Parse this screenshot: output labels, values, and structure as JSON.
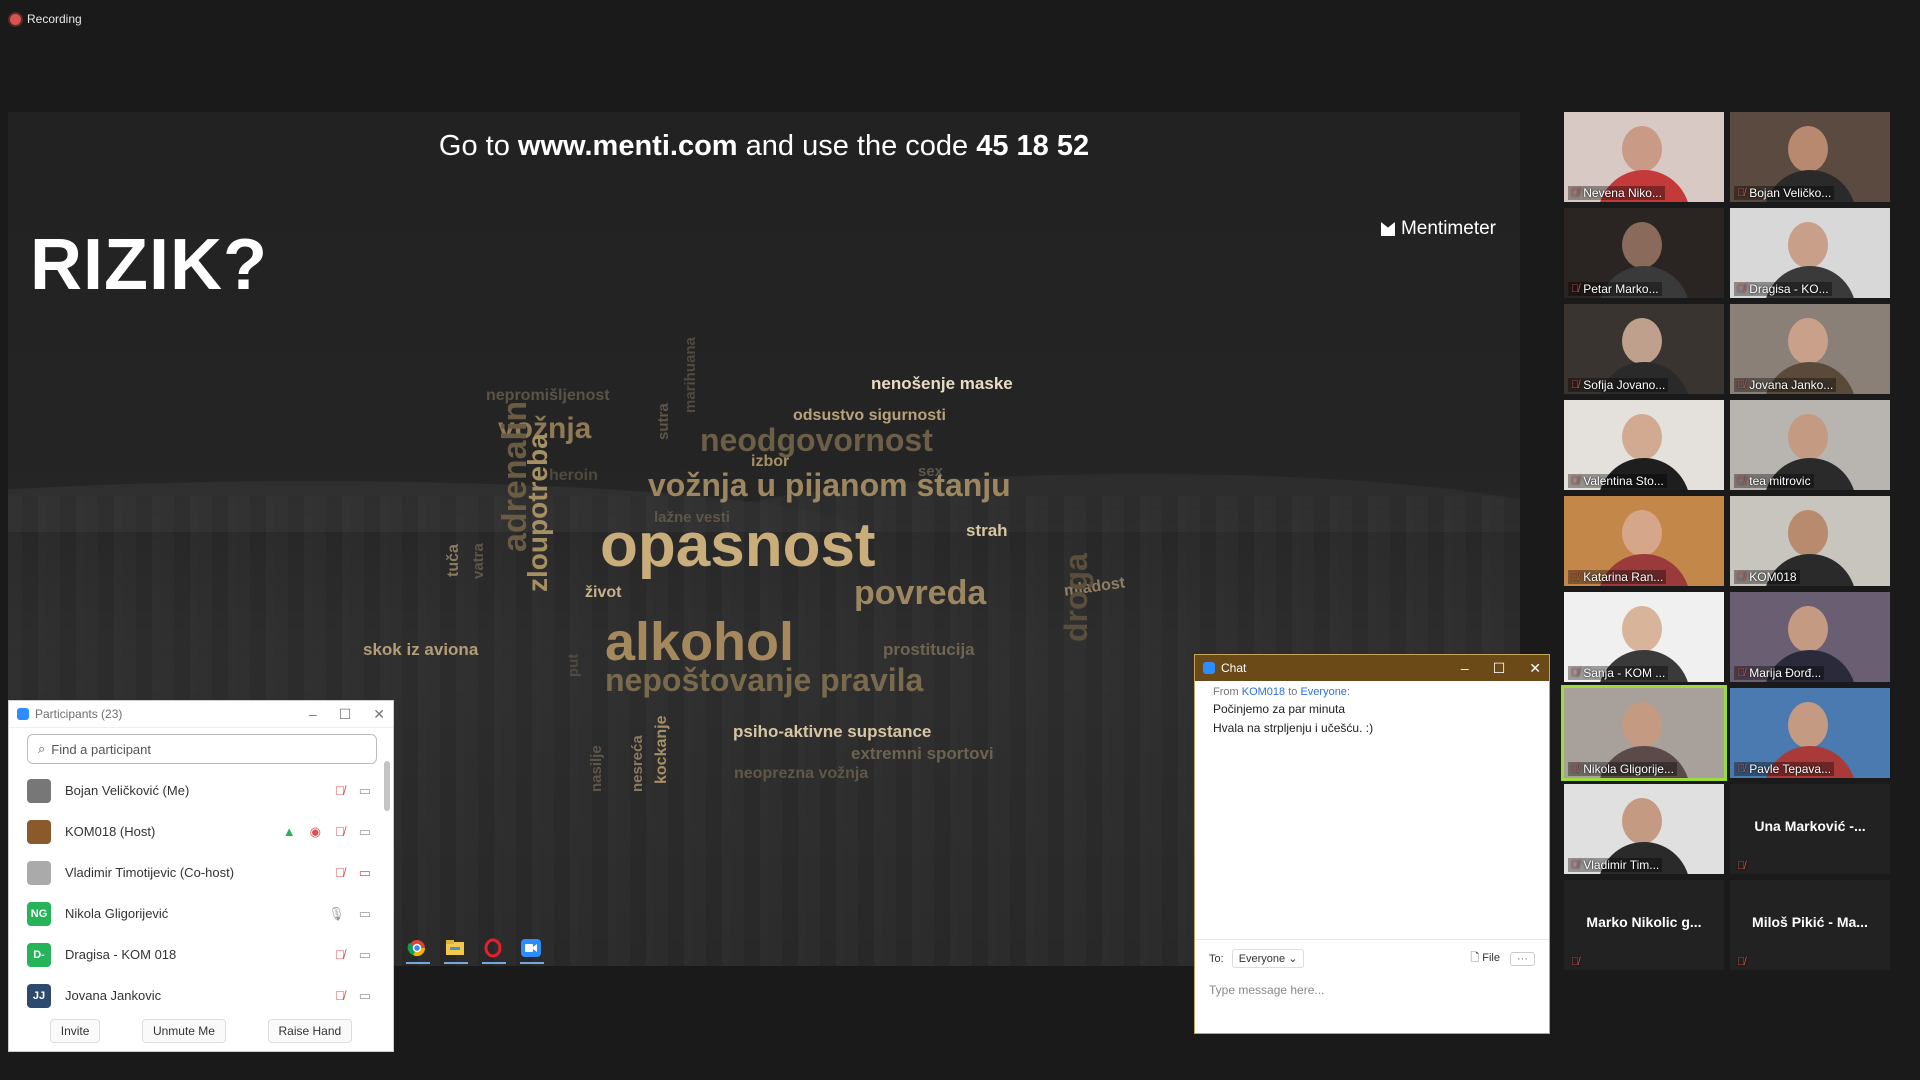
{
  "recording": {
    "label": "Recording"
  },
  "slide": {
    "code_prefix": "Go to ",
    "url": "www.menti.com",
    "code_mid": " and use the code ",
    "code": "45 18 52",
    "brand": "Mentimeter",
    "title": "RIZIK?",
    "words": [
      {
        "text": "nenošenje maske",
        "size": 17,
        "color": "#e8dcc3"
      },
      {
        "text": "nepromišljenost",
        "size": 16,
        "color": "#5a5446"
      },
      {
        "text": "vožnja",
        "size": 30,
        "color": "#8f7a55"
      },
      {
        "text": "sutra",
        "size": 15,
        "color": "#5d564a"
      },
      {
        "text": "marihuana",
        "size": 15,
        "color": "#4f493f"
      },
      {
        "text": "odsustvo sigurnosti",
        "size": 16,
        "color": "#b9a27a"
      },
      {
        "text": "neodgovornost",
        "size": 32,
        "color": "#6c5f48"
      },
      {
        "text": "izbor",
        "size": 16,
        "color": "#a68f63"
      },
      {
        "text": "heroin",
        "size": 16,
        "color": "#4f493f"
      },
      {
        "text": "sex",
        "size": 15,
        "color": "#5d564a"
      },
      {
        "text": "vožnja u pijanom stanju",
        "size": 32,
        "color": "#9d8760"
      },
      {
        "text": "lažne vesti",
        "size": 15,
        "color": "#5d564a"
      },
      {
        "text": "adrenalin",
        "size": 34,
        "color": "#6a5c43"
      },
      {
        "text": "tuča",
        "size": 16,
        "color": "#8a7a5d"
      },
      {
        "text": "vatra",
        "size": 15,
        "color": "#5d564a"
      },
      {
        "text": "zloupotreba",
        "size": 28,
        "color": "#a68f63"
      },
      {
        "text": "opasnost",
        "size": 62,
        "color": "#c9ae7b"
      },
      {
        "text": "strah",
        "size": 17,
        "color": "#d6c6a1"
      },
      {
        "text": "život",
        "size": 16,
        "color": "#c7b38a"
      },
      {
        "text": "povreda",
        "size": 34,
        "color": "#9d8760"
      },
      {
        "text": "mladost",
        "size": 16,
        "color": "#8f7f60"
      },
      {
        "text": "alkohol",
        "size": 54,
        "color": "#a5895d"
      },
      {
        "text": "put",
        "size": 15,
        "color": "#4f493f"
      },
      {
        "text": "droga",
        "size": 32,
        "color": "#5a4f3c"
      },
      {
        "text": "skok iz aviona",
        "size": 17,
        "color": "#b39e78"
      },
      {
        "text": "prostitucija",
        "size": 17,
        "color": "#6f6450"
      },
      {
        "text": "nepoštovanje pravila",
        "size": 32,
        "color": "#7a6a4d"
      },
      {
        "text": "psiho-aktivne supstance",
        "size": 17,
        "color": "#d6c6a1"
      },
      {
        "text": "nasilje",
        "size": 15,
        "color": "#5d564a"
      },
      {
        "text": "nesreća",
        "size": 15,
        "color": "#8a7a5d"
      },
      {
        "text": "kockanje",
        "size": 16,
        "color": "#a68f63"
      },
      {
        "text": "extremni sportovi",
        "size": 17,
        "color": "#6c6250"
      },
      {
        "text": "neoprezna vožnja",
        "size": 16,
        "color": "#5f5848"
      }
    ]
  },
  "participants": {
    "title": "Participants (23)",
    "search_placeholder": "Find a participant",
    "rows": [
      {
        "name": "Bojan Veličković (Me)",
        "initials": "",
        "avatar_color": "#777"
      },
      {
        "name": "KOM018 (Host)",
        "initials": "",
        "avatar_color": "#8a5a2a"
      },
      {
        "name": "Vladimir Timotijevic (Co-host)",
        "initials": "",
        "avatar_color": "#aaa"
      },
      {
        "name": "Nikola Gligorijević",
        "initials": "NG",
        "avatar_color": "#27b35a"
      },
      {
        "name": "Dragisa - KOM 018",
        "initials": "D-",
        "avatar_color": "#27b35a"
      },
      {
        "name": "Jovana Jankovic",
        "initials": "JJ",
        "avatar_color": "#2d4a6e"
      }
    ],
    "buttons": {
      "invite": "Invite",
      "unmute": "Unmute Me",
      "raise": "Raise Hand"
    }
  },
  "chat": {
    "title": "Chat",
    "from_prefix": "From ",
    "from": "KOM018",
    "to_word": " to ",
    "to": "Everyone",
    "to_suffix": ":",
    "messages": [
      "Počinjemo za par minuta",
      "Hvala na strpljenju i učešću. :)"
    ],
    "to_label": "To:",
    "recipient": "Everyone",
    "file": "File",
    "more": "···",
    "input_placeholder": "Type message here..."
  },
  "tiles": [
    {
      "name": "Nevena Niko...",
      "bg": "#d9c9c4",
      "face": "#c99a86",
      "shirt": "#c43a3a"
    },
    {
      "name": "Bojan Veličko...",
      "bg": "#5a4a40",
      "face": "#b8896e",
      "shirt": "#2a2a2a"
    },
    {
      "name": "Petar Marko...",
      "bg": "#2a2422",
      "face": "#8a6a5a",
      "shirt": "#3a3a3a"
    },
    {
      "name": "Dragisa - KO...",
      "bg": "#d8d8d8",
      "face": "#c8a08a",
      "shirt": "#3a3a3a"
    },
    {
      "name": "Sofija Jovano...",
      "bg": "#3a3430",
      "face": "#bfa08c",
      "shirt": "#2a2a2a"
    },
    {
      "name": "Jovana Janko...",
      "bg": "#8a8078",
      "face": "#c9a08a",
      "shirt": "#5a4a3a"
    },
    {
      "name": "Valentina Sto...",
      "bg": "#e4e0dc",
      "face": "#d2aa92",
      "shirt": "#1e1e1e"
    },
    {
      "name": "tea mitrovic",
      "bg": "#b8b4b0",
      "face": "#c49a82",
      "shirt": "#2a2a2a"
    },
    {
      "name": "Katarina Ran...",
      "bg": "#c4874a",
      "face": "#d6a68a",
      "shirt": "#9a3a3a"
    },
    {
      "name": "KOM018",
      "bg": "#c8c4be",
      "face": "#b88a6e",
      "shirt": "#2a2a2a"
    },
    {
      "name": "Sanja - KOM ...",
      "bg": "#f0f0f0",
      "face": "#d8b49a",
      "shirt": "#3a3a3a"
    },
    {
      "name": "Marija Đorđ...",
      "bg": "#6a5e72",
      "face": "#c49a82",
      "shirt": "#2a2a3a"
    },
    {
      "name": "Nikola Gligorije...",
      "bg": "#a8a09a",
      "face": "#c49a82",
      "shirt": "#5a4a4a"
    },
    {
      "name": "Pavle Tepava...",
      "bg": "#4a7ab0",
      "face": "#c49a82",
      "shirt": "#aa3a3a"
    },
    {
      "name": "Vladimir Tim...",
      "bg": "#e0e0e0",
      "face": "#c49a82",
      "shirt": "#2a2a2a"
    },
    {
      "name": "",
      "center": "Una Marković -..."
    },
    {
      "name": "",
      "center": "Marko Nikolic g..."
    },
    {
      "name": "",
      "center": "Miloš Pikić - Ma..."
    }
  ]
}
